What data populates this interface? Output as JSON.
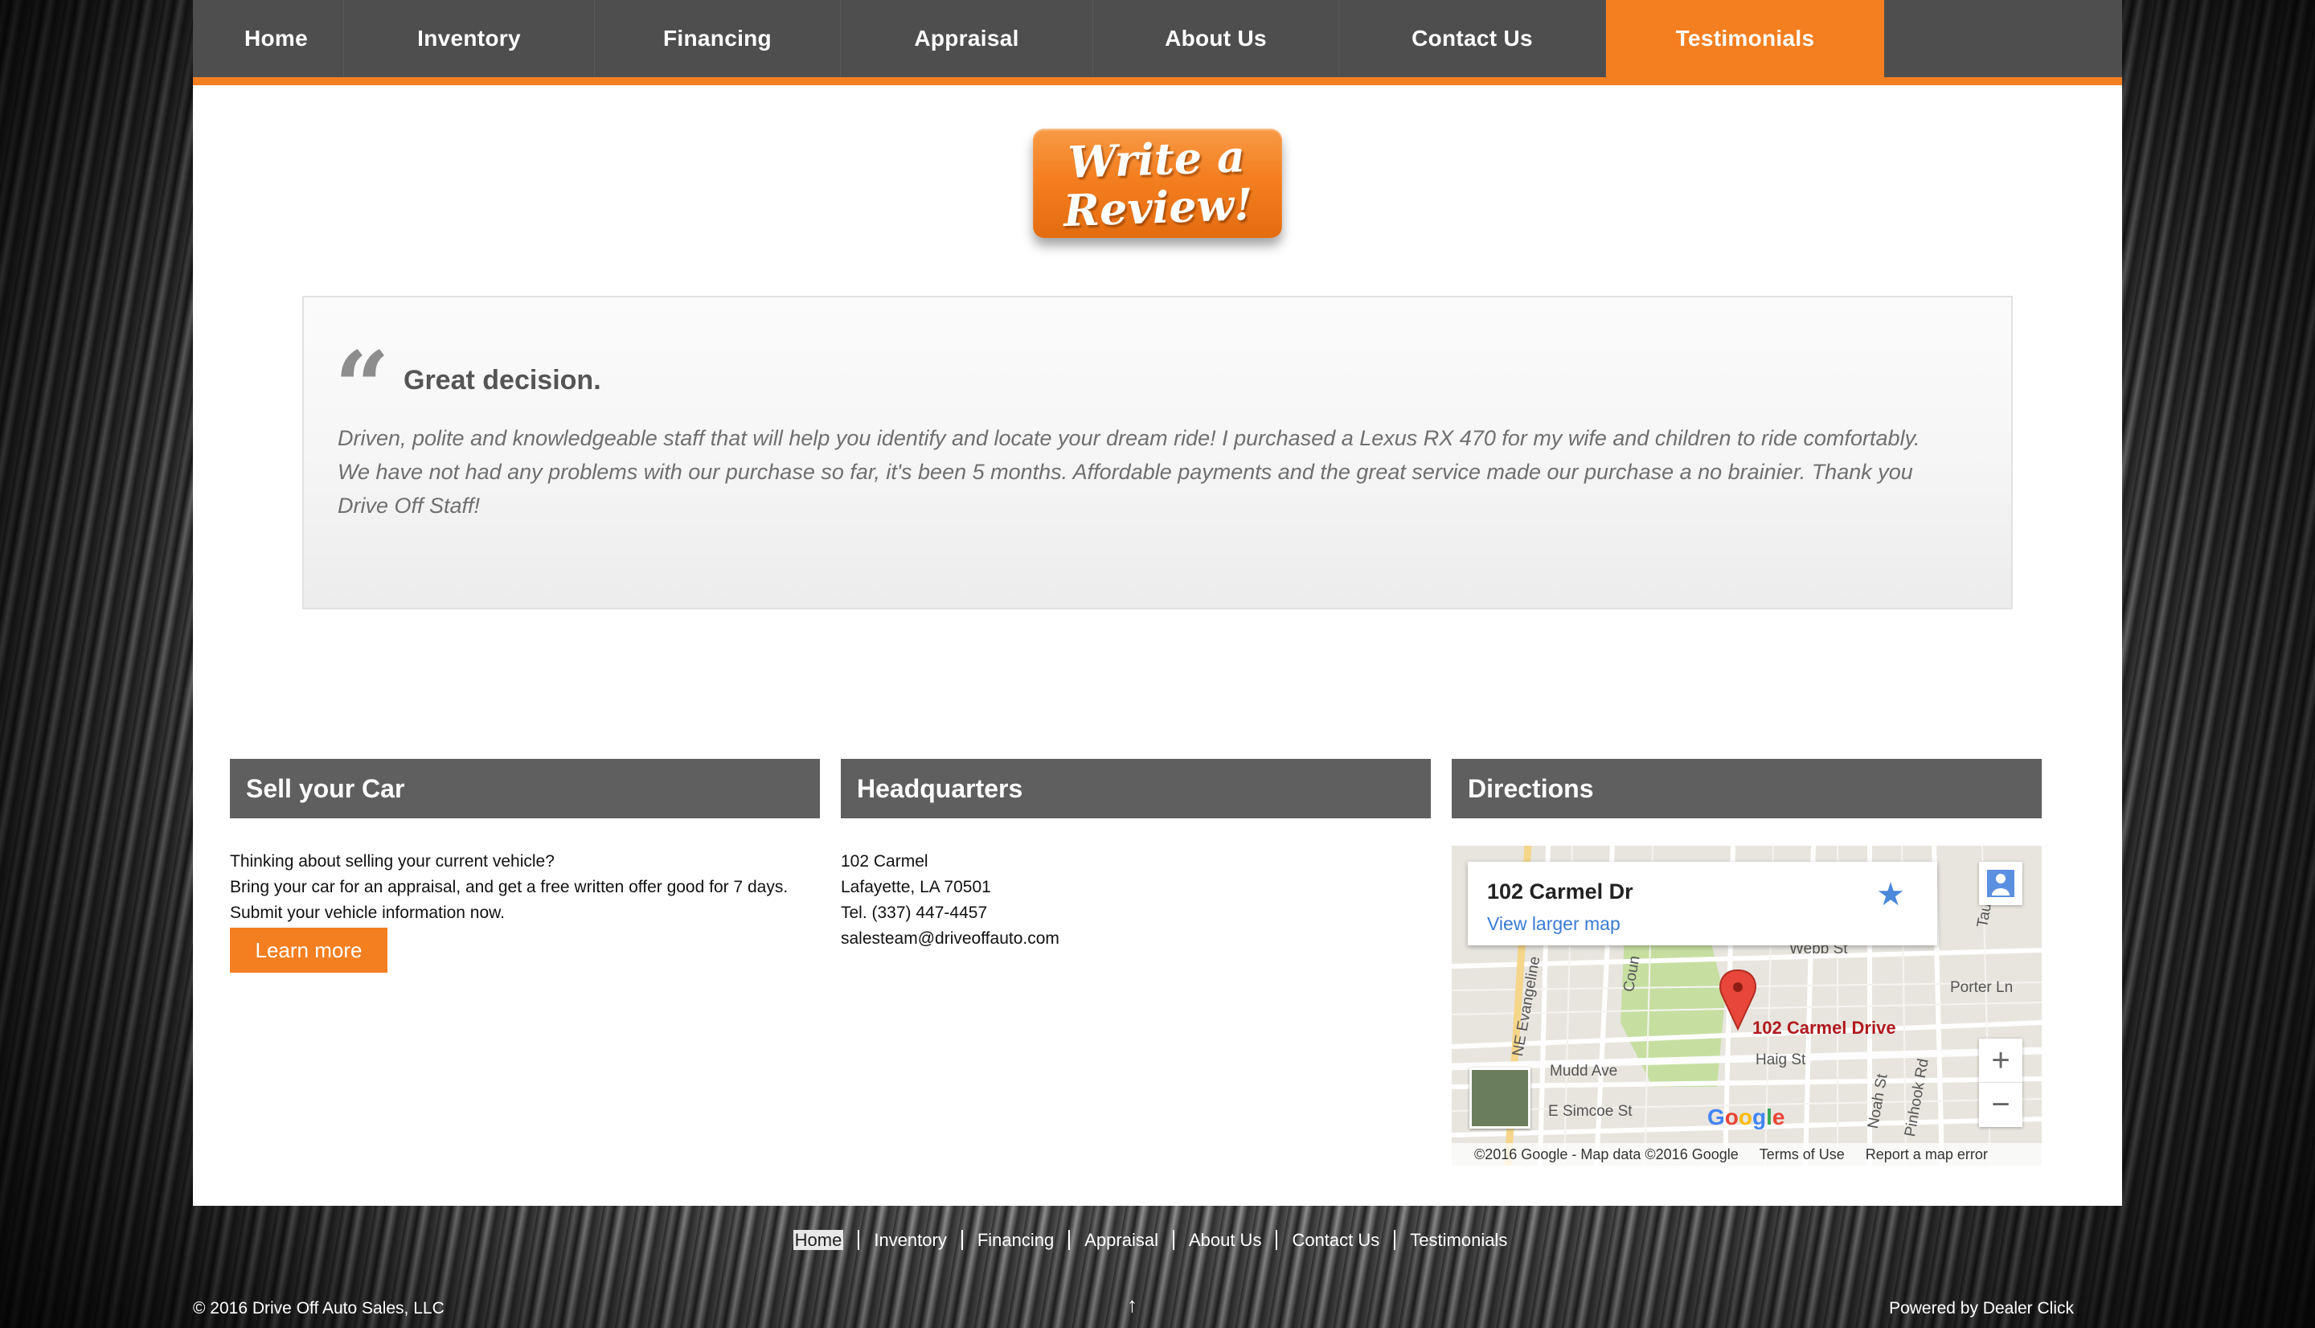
{
  "nav": {
    "items": [
      {
        "label": "Home"
      },
      {
        "label": "Inventory"
      },
      {
        "label": "Financing"
      },
      {
        "label": "Appraisal"
      },
      {
        "label": "About Us"
      },
      {
        "label": "Contact Us"
      },
      {
        "label": "Testimonials",
        "active": true
      }
    ]
  },
  "review_button": {
    "label": "Write a\nReview!"
  },
  "testimonial": {
    "title": "Great decision.",
    "body": "Driven, polite and knowledgeable staff that will help you identify and locate your dream ride! I purchased a Lexus RX 470 for my wife and children to ride comfortably. We have not had any problems with our purchase so far, it's been 5 months. Affordable payments and the great service made our purchase a no brainier. Thank you Drive Off Staff!"
  },
  "sell": {
    "heading": "Sell your Car",
    "line1": "Thinking about selling your current vehicle?",
    "line2": "Bring your car for an appraisal, and get a free written offer good for 7 days.",
    "line3": "Submit your vehicle information now.",
    "button": "Learn more"
  },
  "hq": {
    "heading": "Headquarters",
    "street": "102 Carmel",
    "city": "Lafayette, LA 70501",
    "phone": "Tel. (337) 447-4457",
    "email": "salesteam@driveoffauto.com"
  },
  "directions": {
    "heading": "Directions",
    "map": {
      "address": "102 Carmel Dr",
      "larger_link": "View larger map",
      "marker_label": "102 Carmel Drive",
      "streets": [
        "Webb St",
        "Porter Ln",
        "Haig St",
        "Mudd Ave",
        "E Simcoe St",
        "NE Evangeline",
        "Noah St",
        "Pinhook Rd",
        "Coun",
        "Taurling"
      ],
      "zoom_in": "+",
      "zoom_out": "−",
      "google": "Google",
      "copyright": "©2016 Google - Map data ©2016 Google",
      "terms": "Terms of Use",
      "report": "Report a map error"
    }
  },
  "footer": {
    "links": [
      "Home",
      "Inventory",
      "Financing",
      "Appraisal",
      "About Us",
      "Contact Us",
      "Testimonials"
    ],
    "copyright": "© 2016 Drive Off Auto Sales, LLC",
    "powered": "Powered by Dealer Click",
    "up_arrow": "↑"
  },
  "colors": {
    "accent": "#f47f20",
    "nav_bg": "#4e4e4e",
    "header_bg": "#5f5f5f"
  }
}
